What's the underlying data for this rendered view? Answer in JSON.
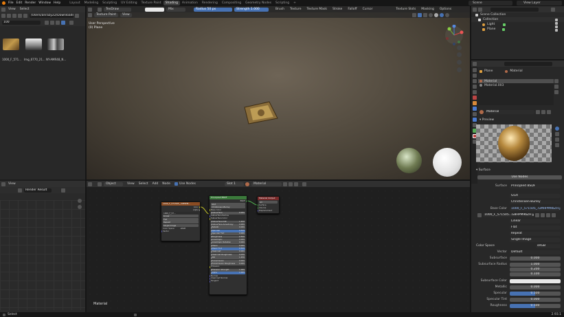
{
  "menubar": {
    "items": [
      "File",
      "Edit",
      "Render",
      "Window",
      "Help"
    ],
    "workspaces": [
      "Layout",
      "Modeling",
      "Sculpting",
      "UV Editing",
      "Texture Paint",
      "Shading",
      "Animation",
      "Rendering",
      "Compositing",
      "Geometry Nodes",
      "Scripting"
    ],
    "active_workspace": "Shading",
    "scene": "Scene",
    "view_layer": "View Layer"
  },
  "file_browser": {
    "view": "View",
    "select": "Select",
    "path": "/Users/anrazy22/Downloads/",
    "search": "100",
    "files": [
      "1000_F_571...",
      "Img_6770_21...",
      "NY-AMR48_N..."
    ]
  },
  "image_editor": {
    "view": "View",
    "render_result": "Render Result"
  },
  "viewport": {
    "mode": "Texture Paint",
    "view": "View",
    "brush": "TexDraw",
    "blend": "Mix",
    "radius_label": "Radius",
    "radius": "50 px",
    "strength_label": "Strength",
    "strength": "1.000",
    "menus": [
      "Brush",
      "Texture",
      "Texture Mask",
      "Stroke",
      "Falloff",
      "Cursor"
    ],
    "texture_slots": "Texture Slots",
    "masking": "Masking",
    "options": "Options",
    "overlay_title": "User Perspective",
    "overlay_sub": "(0) Plane"
  },
  "node_editor": {
    "object": "Object",
    "menus": [
      "View",
      "Select",
      "Add",
      "Node"
    ],
    "use_nodes": "Use Nodes",
    "slot": "Slot 1",
    "material": "Material",
    "footer_label": "Material",
    "image_node": {
      "title": "1000_F_571505_.GBHPM...",
      "out_color": "Color",
      "out_alpha": "Alpha",
      "img": "1000_F_57...",
      "linear": "Linear",
      "flat": "Flat",
      "repeat": "Repeat",
      "single": "Single Image",
      "cs_label": "Color Space",
      "cs": "sRGB",
      "vector": "Vector"
    },
    "bsdf_node": {
      "title": "Principled BSDF",
      "out": "BSDF",
      "dist": "GGX",
      "ss_method": "Christensen-Burley",
      "rows": [
        [
          "Base Color",
          ""
        ],
        [
          "Subsurface",
          "0.000"
        ],
        [
          "Subsurface Radius",
          ""
        ],
        [
          "Subsurface Color",
          ""
        ],
        [
          "Subsurface IOR",
          "1.400"
        ],
        [
          "Subsurface Anisotropy",
          "0.000"
        ],
        [
          "Metallic",
          "0.000"
        ],
        [
          "Specular",
          "0.500"
        ],
        [
          "Specular Tint",
          "0.000"
        ],
        [
          "Roughness",
          "0.500"
        ],
        [
          "Anisotropic",
          "0.000"
        ],
        [
          "Anisotropic Rotation",
          "0.000"
        ],
        [
          "Sheen",
          "0.000"
        ],
        [
          "Sheen Tint",
          "0.500"
        ],
        [
          "Clearcoat",
          "0.000"
        ],
        [
          "Clearcoat Roughness",
          "0.030"
        ],
        [
          "IOR",
          "1.450"
        ],
        [
          "Transmission",
          "0.000"
        ],
        [
          "Transmission Roughness",
          "0.000"
        ],
        [
          "Emission",
          ""
        ],
        [
          "Emission Strength",
          "1.000"
        ],
        [
          "Alpha",
          "1.000"
        ],
        [
          "Normal",
          ""
        ],
        [
          "Clearcoat Normal",
          ""
        ],
        [
          "Tangent",
          ""
        ]
      ]
    },
    "output_node": {
      "title": "Material Output",
      "target": "All",
      "inputs": [
        "Surface",
        "Volume",
        "Displacement"
      ]
    }
  },
  "outliner": {
    "root": "Scene Collection",
    "collection": "Collection",
    "items": [
      "Light",
      "Plane"
    ]
  },
  "properties": {
    "object": "Plane",
    "material": "Material",
    "slots": [
      "Material",
      "Material.003"
    ],
    "mat_name": "Material",
    "preview": "Preview",
    "surface_section": "Surface",
    "use_nodes": "Use Nodes",
    "surface_label": "Surface",
    "surface_value": "Principled BSDF",
    "distribution": "GGX",
    "ss_method": "Christensen-Burley",
    "base_color_label": "Base Color",
    "base_color_value": "1000_F_571505_.GMHPM9bZH.jpg",
    "image_name": "1000_F_571505...G8HPM9bZH.jpg",
    "interp": "Linear",
    "proj": "Flat",
    "ext": "Repeat",
    "source": "Single Image",
    "cs_label": "Color Space",
    "cs": "sRGB",
    "vector_label": "Vector",
    "vector_value": "Default",
    "subsurface_label": "Subsurface",
    "subsurface": "0.000",
    "ss_radius_label": "Subsurface Radius",
    "ss_radius": [
      "1.000",
      "0.200",
      "0.100"
    ],
    "ss_color_label": "Subsurface Color",
    "metallic_label": "Metallic",
    "metallic": "0.000",
    "specular_label": "Specular",
    "specular": "0.500",
    "spec_tint_label": "Specular Tint",
    "spec_tint": "0.000",
    "roughness_label": "Roughness",
    "roughness": "0.500"
  },
  "status": {
    "select": "Select",
    "version": "2.93.1"
  }
}
